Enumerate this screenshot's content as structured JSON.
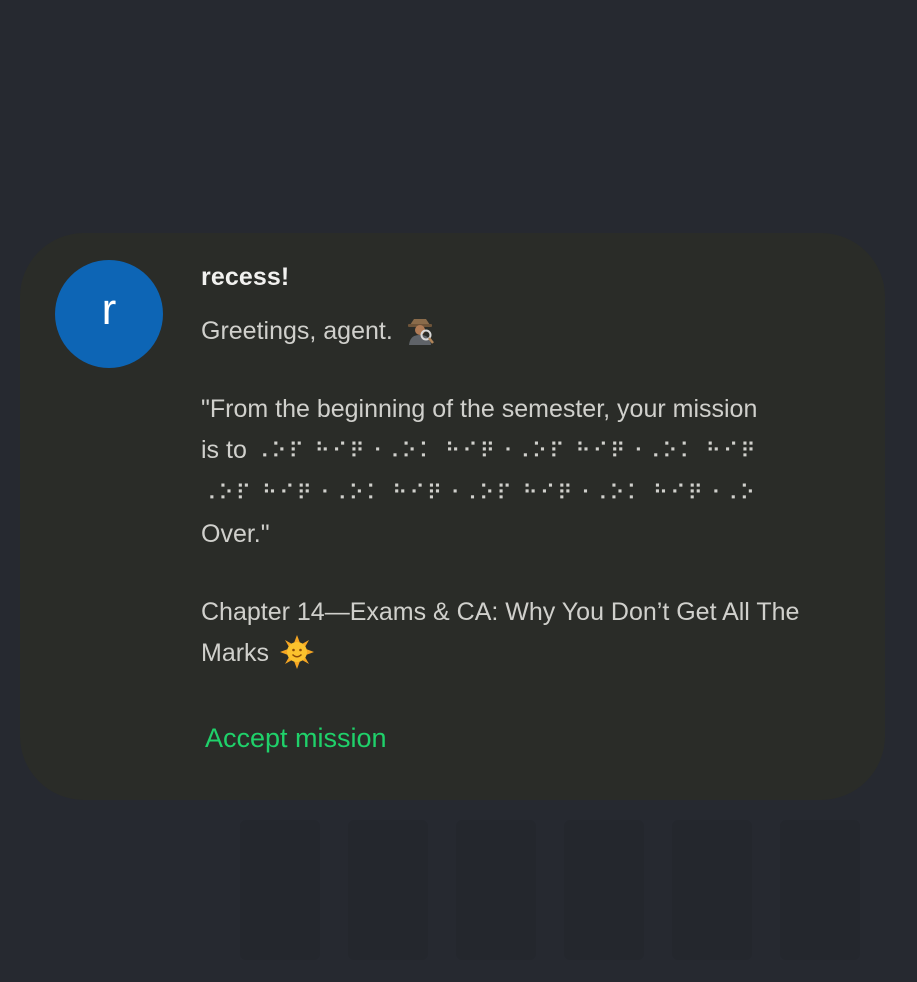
{
  "notification": {
    "avatar_letter": "r",
    "sender": "recess!",
    "greeting": "Greetings, agent.",
    "greeting_icon": "detective-icon",
    "mission_line_1": "\"From the beginning of the semester, your mission",
    "mission_line_2_prefix": "is to",
    "braille_line_2": "⠠⠕⠏ ⠓⠊⠟⠐⠠⠕⠅ ⠓⠊⠟⠐⠠⠕⠏ ⠓⠊⠟⠐⠠⠕⠅ ⠓⠊⠟",
    "braille_line_3": "⠠⠕⠏ ⠓⠊⠟⠐⠠⠕⠅ ⠓⠊⠟⠐⠠⠕⠏ ⠓⠊⠟⠐⠠⠕⠅ ⠓⠊⠟⠐⠠⠕",
    "mission_line_4": "Over.\"",
    "chapter": "Chapter 14—Exams & CA: Why You Don’t Get All The Marks",
    "chapter_icon": "sun-with-face-icon",
    "action_label": "Accept mission"
  },
  "colors": {
    "background": "#262930",
    "card": "#2a2c28",
    "avatar": "#0d65b5",
    "action": "#1fd16a"
  }
}
